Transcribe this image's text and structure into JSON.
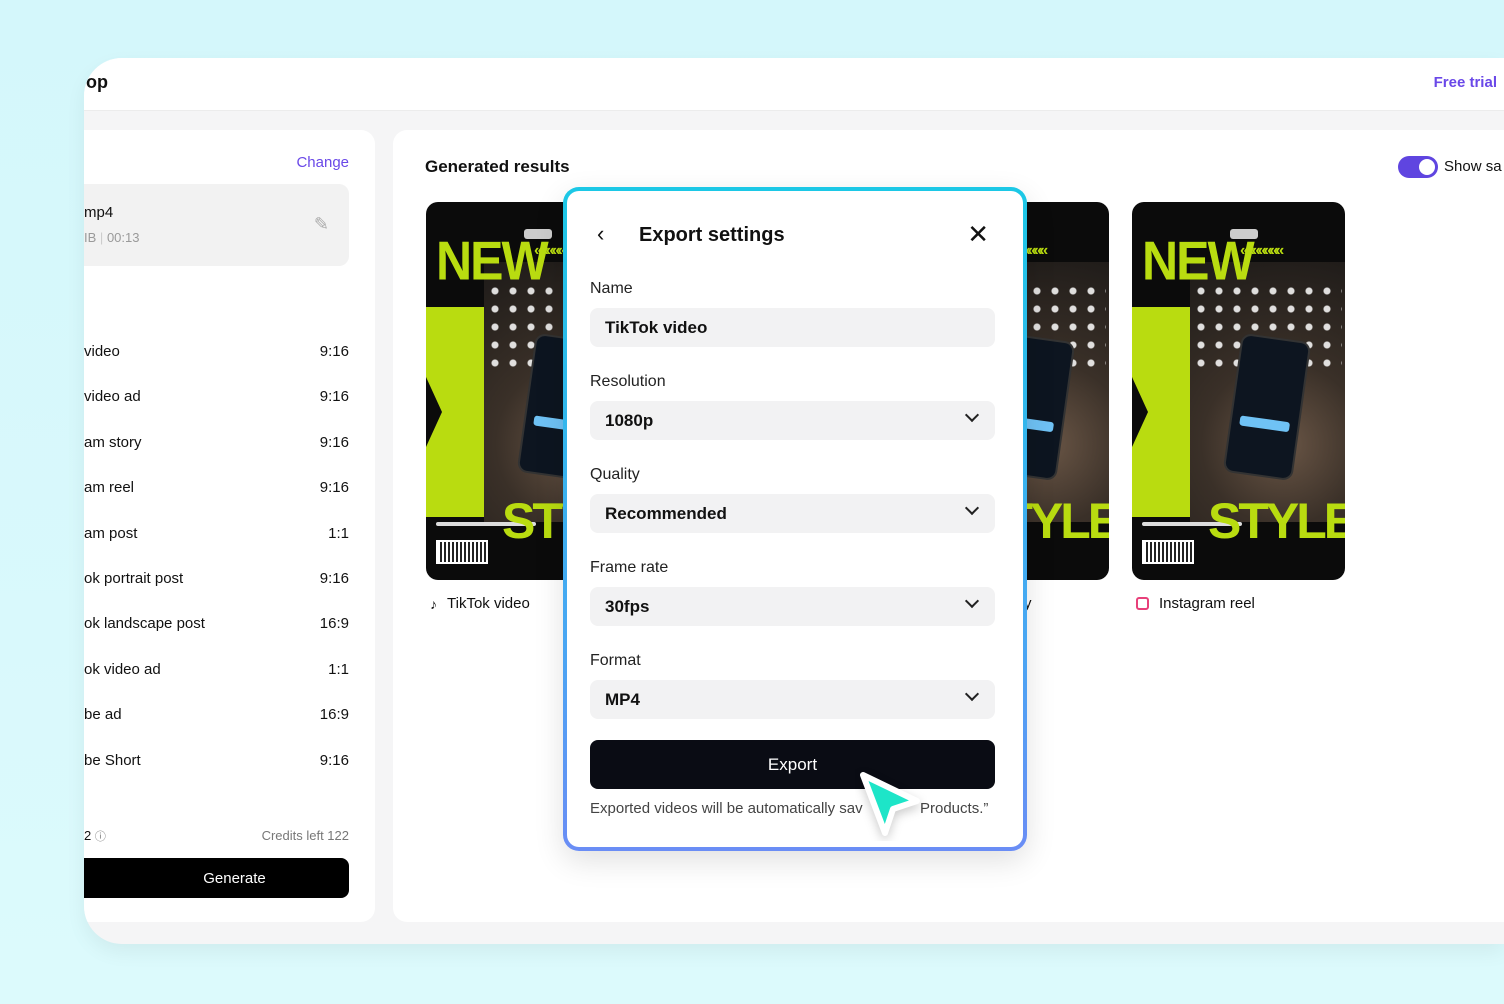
{
  "header": {
    "title": "op",
    "free_trial": "Free trial"
  },
  "left": {
    "change": "Change",
    "file": {
      "name": "mp4",
      "size": "IB",
      "duration": "00:13"
    },
    "formats": [
      {
        "label": "video",
        "ratio": "9:16"
      },
      {
        "label": "video ad",
        "ratio": "9:16"
      },
      {
        "label": "am story",
        "ratio": "9:16"
      },
      {
        "label": "am reel",
        "ratio": "9:16"
      },
      {
        "label": "am post",
        "ratio": "1:1"
      },
      {
        "label": "ok portrait post",
        "ratio": "9:16"
      },
      {
        "label": "ok landscape post",
        "ratio": "16:9"
      },
      {
        "label": "ok video ad",
        "ratio": "1:1"
      },
      {
        "label": "be ad",
        "ratio": "16:9"
      },
      {
        "label": "be Short",
        "ratio": "9:16"
      }
    ],
    "cost": "2",
    "credits": "Credits left 122",
    "generate": "Generate"
  },
  "results": {
    "title": "Generated results",
    "toggle_label": "Show sa",
    "toggle_on": true,
    "thumb_text": {
      "top": "NEW",
      "bottom": "STYLE",
      "chevrons": "«««««««"
    },
    "cards": [
      {
        "caption": "TikTok video",
        "icon": "tiktok-icon"
      },
      {
        "caption": "y",
        "icon": ""
      },
      {
        "caption": "Instagram reel",
        "icon": "instagram-reels-icon"
      }
    ]
  },
  "modal": {
    "title": "Export settings",
    "name_label": "Name",
    "name_value": "TikTok video",
    "resolution_label": "Resolution",
    "resolution_value": "1080p",
    "quality_label": "Quality",
    "quality_value": "Recommended",
    "framerate_label": "Frame rate",
    "framerate_value": "30fps",
    "format_label": "Format",
    "format_value": "MP4",
    "export": "Export",
    "note_left": "Exported videos will be automatically sav",
    "note_right": "Products.”"
  },
  "colors": {
    "accent": "#6a48e8",
    "lime": "#b9dc10",
    "cursor": "#1de5c8",
    "modal_border": "#1cc8e6"
  }
}
